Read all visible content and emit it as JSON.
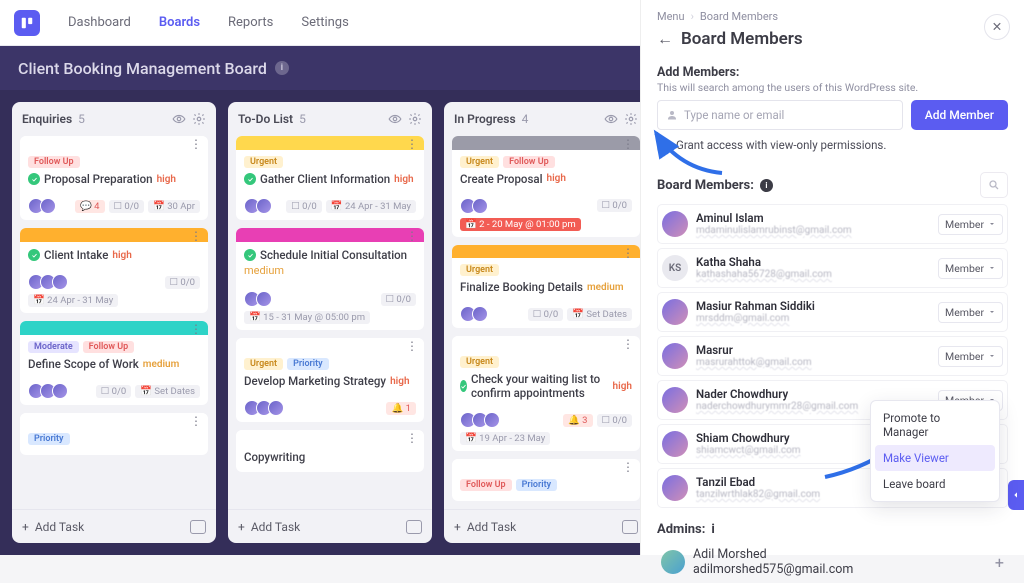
{
  "nav": {
    "dashboard": "Dashboard",
    "boards": "Boards",
    "reports": "Reports",
    "settings": "Settings"
  },
  "board": {
    "title": "Client Booking Management Board"
  },
  "columns": [
    {
      "name": "Enquiries",
      "count": "5",
      "cards": [
        {
          "stripe": "#ffffff",
          "tags": [
            {
              "t": "Follow Up",
              "c": "follow"
            }
          ],
          "check": true,
          "title": "Proposal Preparation",
          "prio": "high",
          "prioc": "high",
          "comments": "4",
          "sub": "0/0",
          "date": "30 Apr",
          "avs": 2,
          "commentRed": true
        },
        {
          "stripe": "#ffb02e",
          "tags": [],
          "check": true,
          "title": "Client Intake",
          "prio": "high",
          "prioc": "high",
          "sub": "0/0",
          "date": "24 Apr - 31 May",
          "avs": 3
        },
        {
          "stripe": "#2ed3c7",
          "tags": [
            {
              "t": "Moderate",
              "c": "moderate"
            },
            {
              "t": "Follow Up",
              "c": "follow"
            }
          ],
          "check": false,
          "title": "Define Scope of Work",
          "prio": "medium",
          "prioc": "medium",
          "sub": "0/0",
          "date": "Set Dates",
          "avs": 3
        },
        {
          "stripe": "#ffffff",
          "tags": [
            {
              "t": "Priority",
              "c": "priority"
            }
          ],
          "check": false,
          "title": "",
          "prio": "",
          "prioc": "",
          "sub": "",
          "date": "",
          "avs": 0
        }
      ]
    },
    {
      "name": "To-Do List",
      "count": "5",
      "cards": [
        {
          "stripe": "#ffd84d",
          "tags": [
            {
              "t": "Urgent",
              "c": "urgent"
            }
          ],
          "check": true,
          "title": "Gather Client Information",
          "prio": "high",
          "prioc": "high",
          "sub": "0/0",
          "date": "24 Apr - 31 May",
          "avs": 2
        },
        {
          "stripe": "#e83fb4",
          "tags": [],
          "check": true,
          "title": "Schedule Initial Consultation",
          "prio": "medium",
          "prioc": "medium",
          "sub": "0/0",
          "date": "15 - 31 May @ 05:00 pm",
          "avs": 2,
          "prioNewline": true
        },
        {
          "stripe": "#ffffff",
          "tags": [
            {
              "t": "Urgent",
              "c": "urgent"
            },
            {
              "t": "Priority",
              "c": "priority"
            }
          ],
          "check": false,
          "title": "Develop Marketing Strategy",
          "prio": "high",
          "prioc": "high",
          "sub": "",
          "date": "",
          "avs": 3,
          "alert": "1"
        },
        {
          "stripe": "#ffffff",
          "tags": [],
          "check": false,
          "title": "Copywriting",
          "prio": "",
          "prioc": "",
          "sub": "",
          "date": "",
          "avs": 0
        }
      ]
    },
    {
      "name": "In Progress",
      "count": "4",
      "cards": [
        {
          "stripe": "#9b9ba8",
          "tags": [
            {
              "t": "Urgent",
              "c": "urgent"
            },
            {
              "t": "Follow Up",
              "c": "follow"
            }
          ],
          "check": false,
          "title": "Create Proposal",
          "prio": "high",
          "prioc": "high",
          "sub": "0/0",
          "date": "2 - 20 May @ 01:00 pm",
          "avs": 2,
          "dateRed": true
        },
        {
          "stripe": "#ffb02e",
          "tags": [
            {
              "t": "Urgent",
              "c": "urgent"
            }
          ],
          "check": false,
          "title": "Finalize Booking Details",
          "prio": "medium",
          "prioc": "medium",
          "sub": "0/0",
          "date": "Set Dates",
          "avs": 2
        },
        {
          "stripe": "#ffffff",
          "tags": [
            {
              "t": "Urgent",
              "c": "urgent"
            }
          ],
          "check": true,
          "title": "Check your waiting list to confirm appointments",
          "prio": "high",
          "prioc": "high",
          "sub": "0/0",
          "date": "19 Apr - 23 May",
          "avs": 3,
          "alert": "3"
        },
        {
          "stripe": "#ffffff",
          "tags": [
            {
              "t": "Follow Up",
              "c": "follow"
            },
            {
              "t": "Priority",
              "c": "priority"
            }
          ],
          "check": false,
          "title": "",
          "prio": "",
          "prioc": "",
          "sub": "",
          "date": "",
          "avs": 0
        }
      ]
    }
  ],
  "addTask": "Add Task",
  "panel": {
    "crumbMenu": "Menu",
    "crumbCurrent": "Board Members",
    "title": "Board Members",
    "addMembersLabel": "Add Members:",
    "addMembersSub": "This will search among the users of this WordPress site.",
    "placeholder": "Type name or email",
    "addBtn": "Add Member",
    "grantCheck": "Grant access with view-only permissions.",
    "membersHead": "Board Members:",
    "members": [
      {
        "name": "Aminul Islam",
        "email": "mdaminulislamrubinst@gmail.com",
        "role": "Member"
      },
      {
        "name": "Katha Shaha",
        "email": "kathashaha56728@gmail.com",
        "role": "Member",
        "initials": "KS"
      },
      {
        "name": "Masiur Rahman Siddiki",
        "email": "mrsddm@gmail.com",
        "role": "Member"
      },
      {
        "name": "Masrur",
        "email": "masrurahttok@gmail.com",
        "role": "Member"
      },
      {
        "name": "Nader Chowdhury",
        "email": "naderchowdhurymmr28@gmail.com",
        "role": "Member"
      },
      {
        "name": "Shiam Chowdhury",
        "email": "shiamcwct@gmail.com",
        "role": ""
      },
      {
        "name": "Tanzil Ebad",
        "email": "tanzilwrthlak82@gmail.com",
        "role": ""
      }
    ],
    "dropdown": {
      "promote": "Promote to Manager",
      "viewer": "Make Viewer",
      "leave": "Leave board"
    },
    "adminsHead": "Admins:",
    "admin": {
      "name": "Adil Morshed",
      "email": "adilmorshed575@gmail.com"
    }
  }
}
